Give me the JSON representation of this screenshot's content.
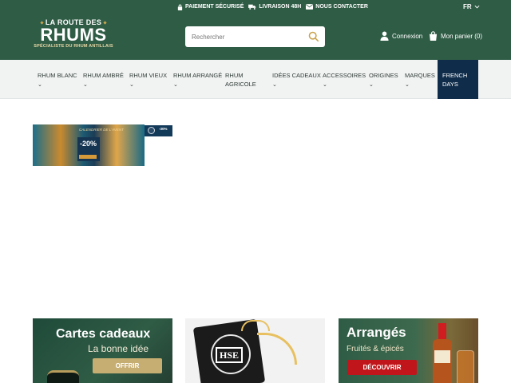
{
  "topbar": {
    "items": [
      {
        "icon": "lock-icon",
        "label": "PAIEMENT SÉCURISÉ"
      },
      {
        "icon": "truck-icon",
        "label": "LIVRAISON 48H"
      },
      {
        "icon": "envelope-icon",
        "label": "NOUS CONTACTER"
      }
    ],
    "lang": "FR"
  },
  "logo": {
    "line1": "LA ROUTE DES",
    "line2": "RHUMS",
    "line3": "SPÉCIALISTE DU RHUM ANTILLAIS"
  },
  "search": {
    "placeholder": "Rechercher"
  },
  "account": {
    "label": "Connexion"
  },
  "cart": {
    "label": "Mon panier (0)"
  },
  "nav": {
    "items": [
      {
        "label": "RHUM BLANC",
        "has_sub": true
      },
      {
        "label": "RHUM AMBRÉ",
        "has_sub": true
      },
      {
        "label": "RHUM VIEUX",
        "has_sub": true
      },
      {
        "label": "RHUM ARRANGÉ",
        "has_sub": true
      },
      {
        "label": "RHUM AGRICOLE",
        "has_sub": false
      },
      {
        "label": "IDÉES CADEAUX",
        "has_sub": true
      },
      {
        "label": "ACCESSOIRES",
        "has_sub": true
      },
      {
        "label": "ORIGINES",
        "has_sub": true
      },
      {
        "label": "MARQUES",
        "has_sub": true
      },
      {
        "label": "FRENCH DAYS",
        "has_sub": false
      }
    ]
  },
  "promo": {
    "title": "CALENDRIER DE L'AVENT",
    "percent": "-20%",
    "badge": "-30%"
  },
  "cards": [
    {
      "title": "Cartes cadeaux",
      "subtitle": "La bonne idée",
      "button": "OFFRIR"
    },
    {
      "brand": "HSE"
    },
    {
      "title": "Arrangés",
      "subtitle": "Fruités & épicés",
      "button": "DÉCOUVRIR"
    }
  ],
  "colors": {
    "primary_green": "#2f5c45",
    "nav_bg": "#f1f3f3",
    "special_nav": "#0f2d4b",
    "gold": "#c6ae72",
    "red": "#c0161b"
  }
}
